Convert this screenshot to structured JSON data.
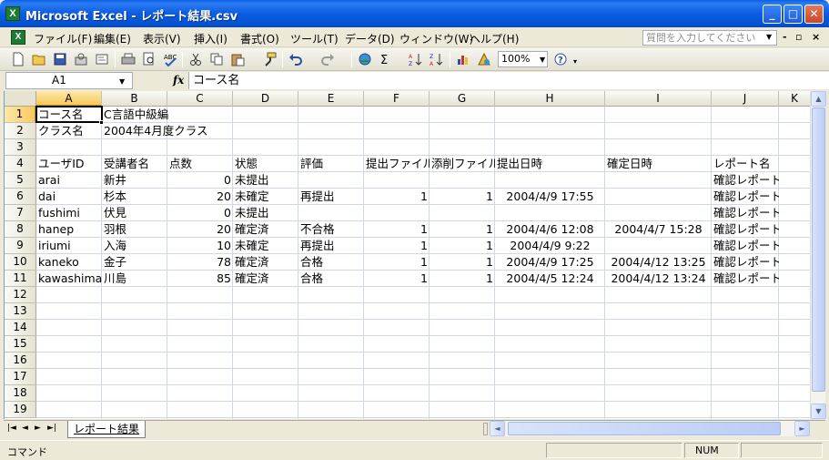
{
  "window": {
    "title": "Microsoft Excel - レポート結果.csv",
    "app_icon": "excel-icon",
    "controls": {
      "minimize": "_",
      "maximize": "□",
      "close": "✕"
    }
  },
  "menu": {
    "items": [
      "ファイル(F)",
      "編集(E)",
      "表示(V)",
      "挿入(I)",
      "書式(O)",
      "ツール(T)",
      "データ(D)",
      "ウィンドウ(W)",
      "ヘルプ(H)"
    ],
    "help_placeholder": "質問を入力してください",
    "mdi_buttons": [
      "-",
      "♂",
      "×"
    ]
  },
  "toolbar": {
    "icons": [
      "new-icon",
      "open-icon",
      "save-icon",
      "permission-icon",
      "email-icon",
      "print-icon",
      "print-preview-icon",
      "spelling-icon",
      "cut-icon",
      "copy-icon",
      "paste-icon",
      "format-painter-icon",
      "undo-icon",
      "redo-icon",
      "hyperlink-icon",
      "autosum-icon",
      "sort-ascending-icon",
      "sort-descending-icon",
      "chart-wizard-icon",
      "drawing-icon",
      "help-icon"
    ],
    "zoom": "100%"
  },
  "formula_bar": {
    "name_box": "A1",
    "fx": "fx",
    "content": "コース名"
  },
  "grid": {
    "columns": [
      "A",
      "B",
      "C",
      "D",
      "E",
      "F",
      "G",
      "H",
      "I",
      "J",
      "K"
    ],
    "row_numbers": [
      "1",
      "2",
      "3",
      "4",
      "5",
      "6",
      "7",
      "8",
      "9",
      "10",
      "11",
      "12",
      "13",
      "14",
      "15",
      "16",
      "17",
      "18",
      "19"
    ],
    "rows": [
      [
        "コース名",
        "C言語中級編",
        "",
        "",
        "",
        "",
        "",
        "",
        "",
        ""
      ],
      [
        "クラス名",
        "2004年4月度クラス",
        "",
        "",
        "",
        "",
        "",
        "",
        "",
        ""
      ],
      [
        "",
        "",
        "",
        "",
        "",
        "",
        "",
        "",
        "",
        ""
      ],
      [
        "ユーザID",
        "受講者名",
        "点数",
        "状態",
        "評価",
        "提出ファイル",
        "添削ファイル",
        "提出日時",
        "確定日時",
        "レポート名"
      ],
      [
        "arai",
        "新井",
        "0",
        "未提出",
        "",
        "",
        "",
        "",
        "",
        "確認レポート"
      ],
      [
        "dai",
        "杉本",
        "20",
        "未確定",
        "再提出",
        "1",
        "1",
        "2004/4/9 17:55",
        "",
        "確認レポート"
      ],
      [
        "fushimi",
        "伏見",
        "0",
        "未提出",
        "",
        "",
        "",
        "",
        "",
        "確認レポート"
      ],
      [
        "hanep",
        "羽根",
        "20",
        "確定済",
        "不合格",
        "1",
        "1",
        "2004/4/6 12:08",
        "2004/4/7 15:28",
        "確認レポート"
      ],
      [
        "iriumi",
        "入海",
        "10",
        "未確定",
        "再提出",
        "1",
        "1",
        "2004/4/9 9:22",
        "",
        "確認レポート"
      ],
      [
        "kaneko",
        "金子",
        "78",
        "確定済",
        "合格",
        "1",
        "1",
        "2004/4/9 17:25",
        "2004/4/12 13:25",
        "確認レポート"
      ],
      [
        "kawashima",
        "川島",
        "85",
        "確定済",
        "合格",
        "1",
        "1",
        "2004/4/5 12:24",
        "2004/4/12 13:24",
        "確認レポート"
      ]
    ]
  },
  "sheet_tabs": {
    "nav": [
      "|◄",
      "◄",
      "►",
      "►|"
    ],
    "active": "レポート結果"
  },
  "status": {
    "mode": "コマンド",
    "num": "NUM"
  }
}
